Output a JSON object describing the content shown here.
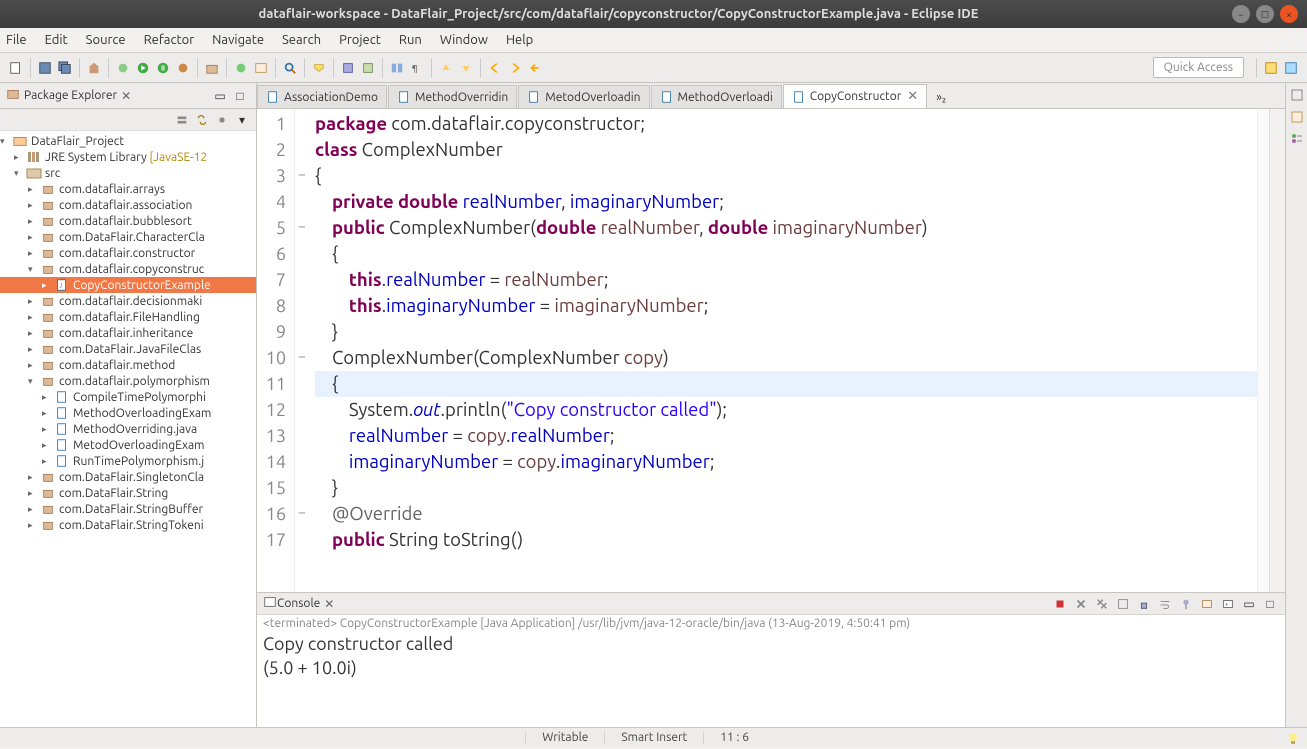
{
  "window": {
    "title": "dataflair-workspace - DataFlair_Project/src/com/dataflair/copyconstructor/CopyConstructorExample.java - Eclipse IDE"
  },
  "menu": [
    "File",
    "Edit",
    "Source",
    "Refactor",
    "Navigate",
    "Search",
    "Project",
    "Run",
    "Window",
    "Help"
  ],
  "quick_access_placeholder": "Quick Access",
  "package_explorer": {
    "title": "Package Explorer",
    "project": "DataFlair_Project",
    "jre": "JRE System Library",
    "jre_hint": "[JavaSE-12",
    "src": "src",
    "packages": [
      "com.dataflair.arrays",
      "com.dataflair.association",
      "com.dataflair.bubblesort",
      "com.DataFlair.CharacterCla",
      "com.dataflair.constructor",
      "com.dataflair.copyconstruc",
      "com.dataflair.decisionmaki",
      "com.dataflair.FileHandling",
      "com.dataflair.inheritance",
      "com.DataFlair.JavaFileClas",
      "com.dataflair.method",
      "com.dataflair.polymorphism",
      "com.DataFlair.SingletonCla",
      "com.DataFlair.String",
      "com.DataFlair.StringBuffer",
      "com.DataFlair.StringTokeni"
    ],
    "copy_file": "CopyConstructorExample",
    "poly_files": [
      "CompileTimePolymorphi",
      "MethodOverloadingExam",
      "MethodOverriding.java",
      "MetodOverloadingExam",
      "RunTimePolymorphism.j"
    ]
  },
  "editor": {
    "tabs": [
      "AssociationDemo",
      "MethodOverridin",
      "MetodOverloadin",
      "MethodOverloadi",
      "CopyConstructor"
    ],
    "active_tab_index": 4,
    "show_more": "»₂",
    "line_numbers": [
      "1",
      "2",
      "3",
      "4",
      "5",
      "6",
      "7",
      "8",
      "9",
      "10",
      "11",
      "12",
      "13",
      "14",
      "15",
      "16",
      "17"
    ],
    "fold_marks": [
      "",
      "",
      "−",
      "",
      "−",
      "",
      "",
      "",
      "",
      "−",
      "",
      "",
      "",
      "",
      "",
      "−",
      ""
    ]
  },
  "console": {
    "title": "Console",
    "launch_info": "<terminated> CopyConstructorExample [Java Application] /usr/lib/jvm/java-12-oracle/bin/java (13-Aug-2019, 4:50:41 pm)",
    "output1": "Copy constructor called",
    "output2": "(5.0 + 10.0i)"
  },
  "status": {
    "writable": "Writable",
    "insert": "Smart Insert",
    "cursor": "11 : 6"
  }
}
